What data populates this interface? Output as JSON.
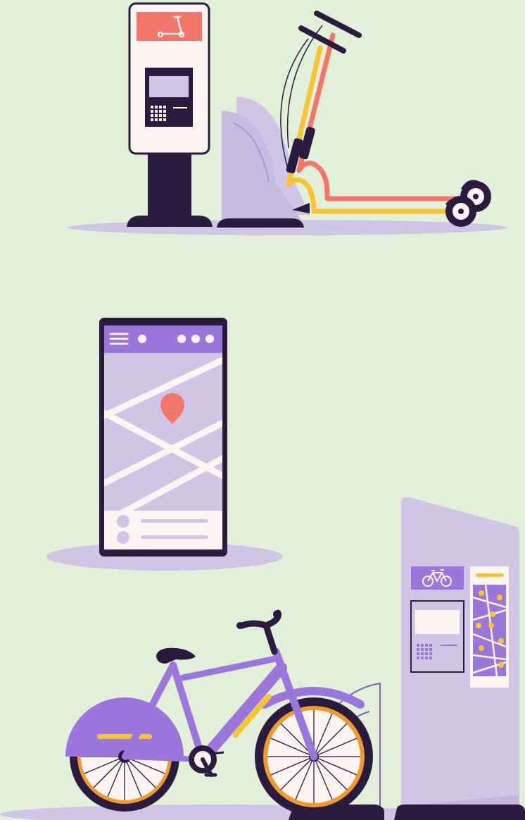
{
  "scene": {
    "background": "#e2efd9",
    "palette": {
      "dark": "#2b1b3f",
      "lavender": "#cfc6e6",
      "purple": "#9b77dc",
      "coral": "#f2766a",
      "yellow": "#f7c534",
      "orange": "#f09a2b",
      "cream": "#fdf5f2"
    }
  },
  "icons": {
    "scooter_sign": "scooter-icon",
    "bike_sign": "bicycle-icon",
    "map_pin": "map-pin-icon",
    "menu": "hamburger-menu-icon",
    "more": "more-dots-icon"
  }
}
